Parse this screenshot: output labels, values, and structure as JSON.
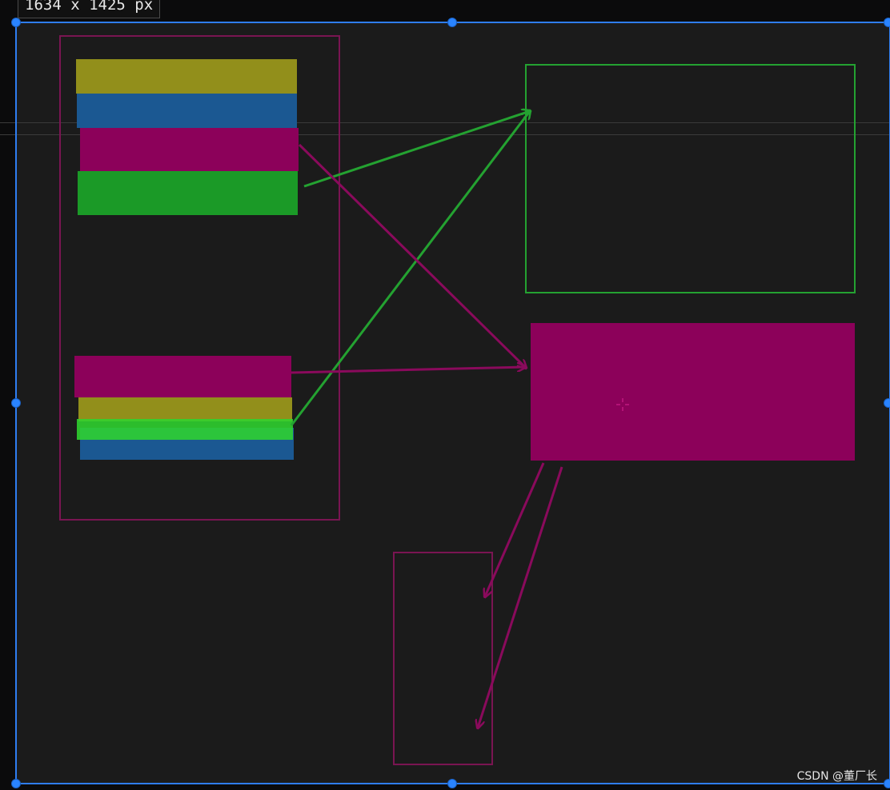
{
  "dimension_label": "1634 x 1425 px",
  "watermark": "CSDN @董厂长",
  "colors": {
    "canvas_bg": "#1b1b1b",
    "selection_blue": "#2f7df0",
    "olive": "#928f1b",
    "steel_blue": "#1b5892",
    "magenta": "#8c015a",
    "green": "#1b9a27",
    "bright_green": "#2fd42f",
    "magenta_outline": "#7a1552",
    "green_outline": "#24a231",
    "guide_line": "#3b3b3b"
  }
}
